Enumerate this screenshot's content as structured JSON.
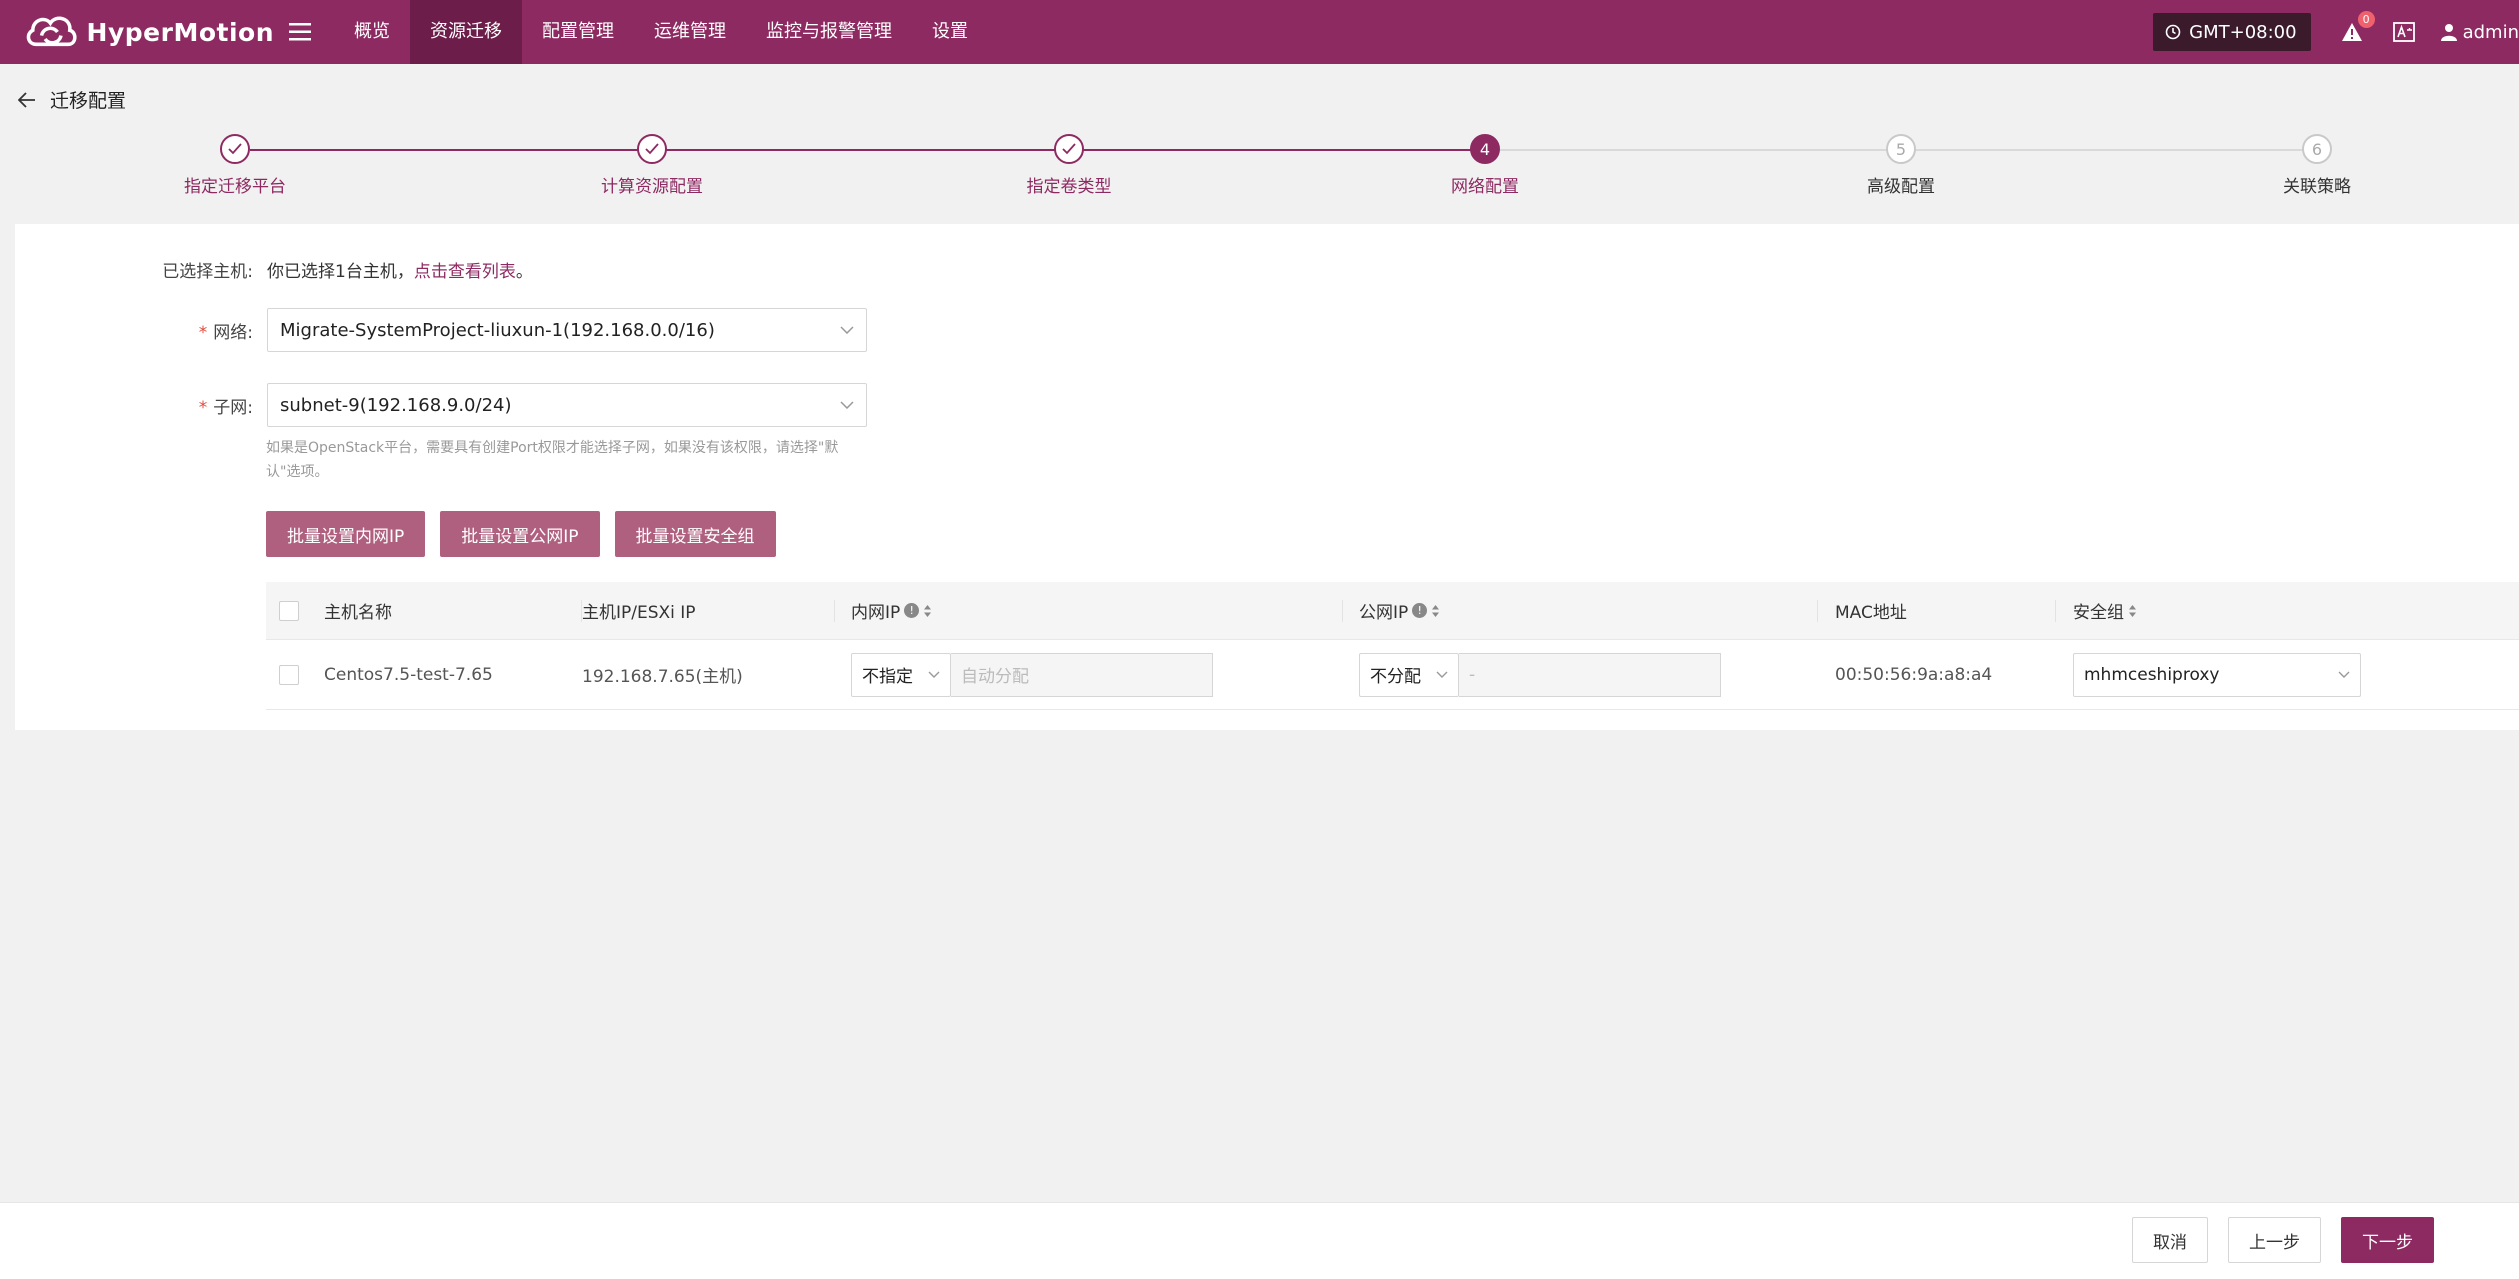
{
  "header": {
    "brand": "HyperMotion",
    "nav": [
      "概览",
      "资源迁移",
      "配置管理",
      "运维管理",
      "监控与报警管理",
      "设置"
    ],
    "active_nav": "资源迁移",
    "timezone": "GMT+08:00",
    "alert_count": "0",
    "user": "admin",
    "brand_color": "#8e2a62"
  },
  "page": {
    "title": "迁移配置"
  },
  "steps": [
    {
      "label": "指定迁移平台",
      "index": "1",
      "state": "done"
    },
    {
      "label": "计算资源配置",
      "index": "2",
      "state": "done"
    },
    {
      "label": "指定卷类型",
      "index": "3",
      "state": "done"
    },
    {
      "label": "网络配置",
      "index": "4",
      "state": "current"
    },
    {
      "label": "高级配置",
      "index": "5",
      "state": "todo"
    },
    {
      "label": "关联策略",
      "index": "6",
      "state": "todo"
    }
  ],
  "form": {
    "selected_label": "已选择主机:",
    "selected_text": "你已选择1台主机，",
    "selected_link": "点击查看列表",
    "selected_end": "。",
    "network_label": "网络:",
    "network_value": "Migrate-SystemProject-liuxun-1(192.168.0.0/16)",
    "subnet_label": "子网:",
    "subnet_value": "subnet-9(192.168.9.0/24)",
    "hint": "如果是OpenStack平台，需要具有创建Port权限才能选择子网，如果没有该权限，请选择\"默认\"选项。"
  },
  "batch_buttons": {
    "private_ip": "批量设置内网IP",
    "public_ip": "批量设置公网IP",
    "security_group": "批量设置安全组"
  },
  "table": {
    "columns": {
      "host_name": "主机名称",
      "host_ip": "主机IP/ESXi IP",
      "private_ip": "内网IP",
      "public_ip": "公网IP",
      "mac": "MAC地址",
      "security_group": "安全组"
    },
    "rows": [
      {
        "host_name": "Centos7.5-test-7.65",
        "host_ip": "192.168.7.65(主机)",
        "private_ip_mode": "不指定",
        "private_ip_placeholder": "自动分配",
        "public_ip_mode": "不分配",
        "public_ip_placeholder": "-",
        "mac": "00:50:56:9a:a8:a4",
        "security_group": "mhmceshiproxy"
      }
    ]
  },
  "footer": {
    "cancel": "取消",
    "prev": "上一步",
    "next": "下一步"
  }
}
